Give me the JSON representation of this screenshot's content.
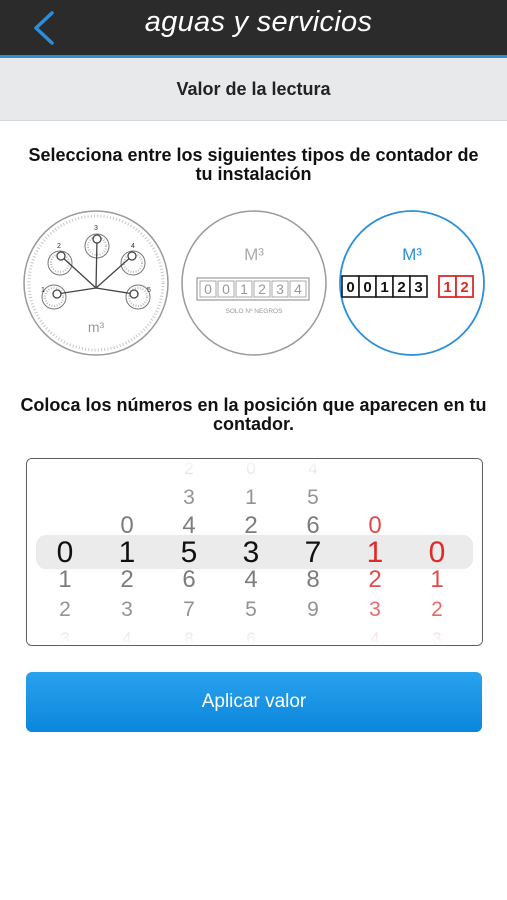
{
  "colors": {
    "nav_bg": "#2b2b2b",
    "accent": "#2a8fd8",
    "header_bg": "#e8e9ea",
    "red": "#e02a2a",
    "button_blue": "#0a86dc"
  },
  "nav": {
    "title": "aguas y servicios",
    "back_icon": "chevron-left-icon"
  },
  "section": {
    "title": "Valor de la lectura"
  },
  "instructions": {
    "meter_type": "Selecciona entre los siguientes tipos de contador de tu instalación",
    "position": "Coloca los números en la posición que aparecen en tu contador."
  },
  "meter_types": {
    "dial": {
      "unit": "m³",
      "dial_numbers": [
        "1",
        "2",
        "3",
        "4",
        "5"
      ]
    },
    "black_only": {
      "unit": "M³",
      "digits": [
        "0",
        "0",
        "1",
        "2",
        "3",
        "4"
      ],
      "caption": "SOLO Nº NEGROS"
    },
    "black_red": {
      "unit": "M³",
      "black_digits": [
        "0",
        "0",
        "1",
        "2",
        "3"
      ],
      "red_digits": [
        "1",
        "2"
      ],
      "selected": true
    }
  },
  "picker": {
    "wheels": [
      {
        "color": "black",
        "value": "0",
        "above": [],
        "below": [
          "1",
          "2",
          "3"
        ]
      },
      {
        "color": "black",
        "value": "1",
        "above": [
          "0"
        ],
        "below": [
          "2",
          "3",
          "4"
        ]
      },
      {
        "color": "black",
        "value": "5",
        "above": [
          "2",
          "3",
          "4"
        ],
        "below": [
          "6",
          "7",
          "8"
        ]
      },
      {
        "color": "black",
        "value": "3",
        "above": [
          "0",
          "1",
          "2"
        ],
        "below": [
          "4",
          "5",
          "6"
        ]
      },
      {
        "color": "black",
        "value": "7",
        "above": [
          "4",
          "5",
          "6"
        ],
        "below": [
          "8",
          "9"
        ]
      },
      {
        "color": "red",
        "value": "1",
        "above": [
          "0"
        ],
        "below": [
          "2",
          "3",
          "4"
        ]
      },
      {
        "color": "red",
        "value": "0",
        "above": [],
        "below": [
          "1",
          "2",
          "3"
        ]
      }
    ]
  },
  "apply_button": {
    "label": "Aplicar valor"
  }
}
